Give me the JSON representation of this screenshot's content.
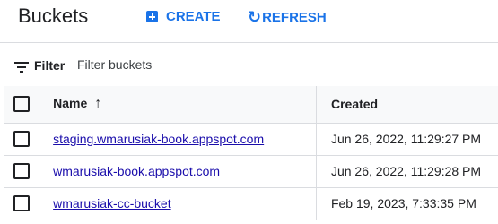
{
  "header": {
    "title": "Buckets",
    "create_label": "CREATE",
    "refresh_label": "REFRESH"
  },
  "filter": {
    "label": "Filter",
    "placeholder": "Filter buckets"
  },
  "table": {
    "columns": {
      "name": "Name",
      "created": "Created"
    },
    "sort": {
      "column": "name",
      "direction": "ascending"
    },
    "rows": [
      {
        "name": "staging.wmarusiak-book.appspot.com",
        "created": "Jun 26, 2022, 11:29:27 PM"
      },
      {
        "name": "wmarusiak-book.appspot.com",
        "created": "Jun 26, 2022, 11:29:28 PM"
      },
      {
        "name": "wmarusiak-cc-bucket",
        "created": "Feb 19, 2023, 7:33:35 PM"
      }
    ]
  },
  "colors": {
    "accent": "#1a73e8",
    "link": "#1a0dab",
    "header_row_bg": "#f8f9fa",
    "divider": "#dadce0"
  },
  "icons": {
    "create": "add-box-icon",
    "refresh": "refresh-icon",
    "filter": "filter-lines-icon",
    "sort": "arrow-up-icon"
  }
}
